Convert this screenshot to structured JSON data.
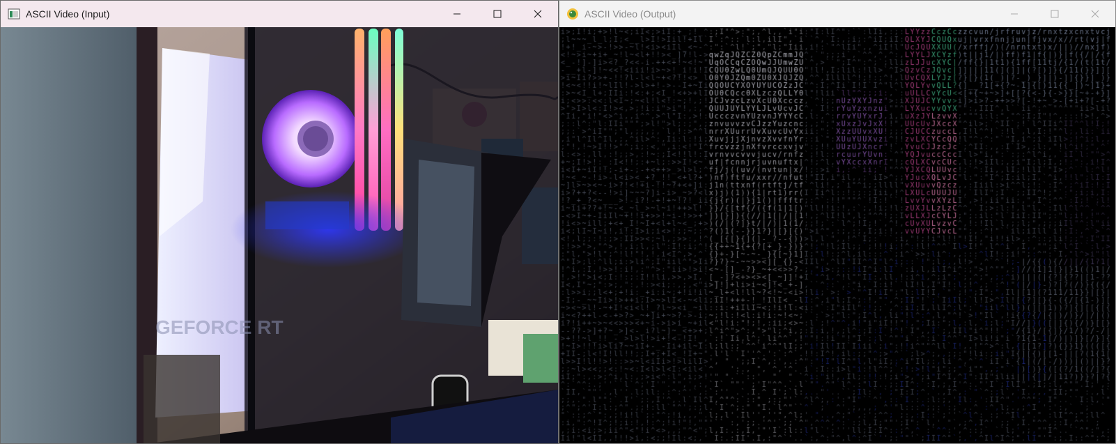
{
  "input_window": {
    "title": "ASCII Video (Input)",
    "icon": "app-window-icon",
    "controls": [
      "minimize-icon",
      "maximize-icon",
      "close-icon"
    ],
    "scene_text": "GEFORCE RT"
  },
  "output_window": {
    "title": "ASCII Video (Output)",
    "icon": "python-snake-icon",
    "controls": [
      "minimize-icon",
      "maximize-icon",
      "close-icon"
    ],
    "state": "inactive",
    "charset": " .'`^\",:;Il!i><~+_-?][}{1)(|/tfjrxnuvczXYUJCLQ0OZmwqpdbkhao*#MW&8%B@$"
  },
  "colors": {
    "input_titlebar": "#f4e8ee",
    "output_titlebar": "#f3f3f3",
    "ascii_background": "#000000",
    "rgb_led_pink": "#ff5ab4",
    "rgb_led_green": "#6affc0",
    "fan_purple": "#b86bff"
  }
}
